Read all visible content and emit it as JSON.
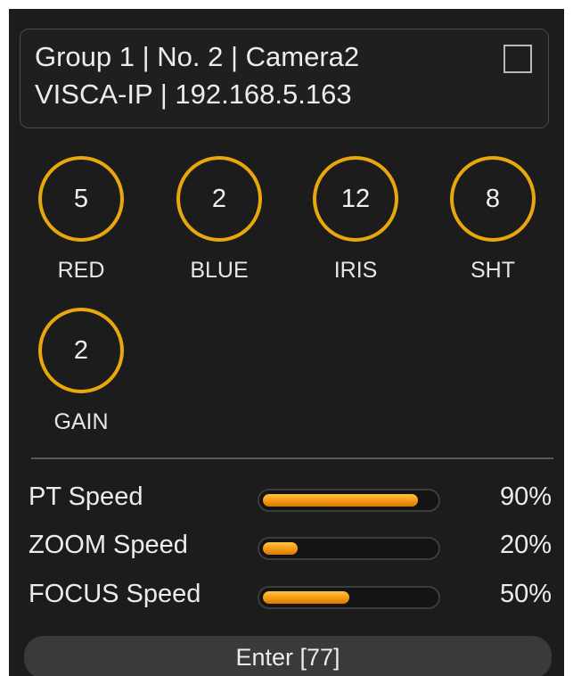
{
  "header": {
    "line1": "Group 1 | No. 2 | Camera2",
    "line2": "VISCA-IP | 192.168.5.163",
    "checkbox_checked": false
  },
  "knobs": [
    {
      "value": "5",
      "label": "RED"
    },
    {
      "value": "2",
      "label": "BLUE"
    },
    {
      "value": "12",
      "label": "IRIS"
    },
    {
      "value": "8",
      "label": "SHT"
    },
    {
      "value": "2",
      "label": "GAIN"
    }
  ],
  "speeds": [
    {
      "label": "PT Speed",
      "value_text": "90%",
      "level": 0.9
    },
    {
      "label": "ZOOM Speed",
      "value_text": "20%",
      "level": 0.2
    },
    {
      "label": "FOCUS Speed",
      "value_text": "50%",
      "level": 0.5
    }
  ],
  "enter_button": {
    "label": "Enter [77]"
  },
  "colors": {
    "accent": "#e8a70c",
    "bar_fill": "#f39a12",
    "background": "#1c1c1c",
    "text": "#ececec"
  }
}
